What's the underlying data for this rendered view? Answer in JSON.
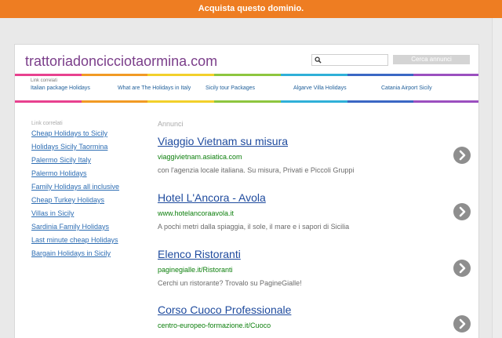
{
  "top_banner": {
    "label": "Acquista questo dominio."
  },
  "site": {
    "title": "trattoriadoncicciotaormina.com"
  },
  "search": {
    "placeholder": "",
    "button_label": "Cerca annunci"
  },
  "top_related": {
    "label": "Link correlati",
    "items": [
      "Italian package Holidays",
      "What are The Holidays in Italy",
      "Sicily tour Packages",
      "Algarve Villa Holidays",
      "Catania Airport Sicily"
    ]
  },
  "sidebar": {
    "label": "Link correlati",
    "items": [
      "Cheap Holidays to Sicily",
      "Holidays Sicily Taormina",
      "Palermo Sicily Italy",
      "Palermo Holidays",
      "Family Holidays all inclusive",
      "Cheap Turkey Holidays",
      "Villas in Sicily",
      "Sardinia Family Holidays",
      "Last minute cheap Holidays",
      "Bargain Holidays in Sicily"
    ]
  },
  "ads": {
    "label": "Annunci",
    "items": [
      {
        "title": "Viaggio Vietnam su misura",
        "url": "viaggivietnam.asiatica.com",
        "desc": "con l'agenzia locale italiana. Su misura, Privati e Piccoli Gruppi"
      },
      {
        "title": "Hotel L'Ancora - Avola",
        "url": "www.hotelancoraavola.it",
        "desc": "A pochi metri dalla spiaggia, il sole, il mare e i sapori di Sicilia"
      },
      {
        "title": "Elenco Ristoranti",
        "url": "paginegialle.it/Ristoranti",
        "desc": "Cerchi un ristorante? Trovalo su PagineGialle!"
      },
      {
        "title": "Corso Cuoco Professionale",
        "url": "centro-europeo-formazione.it/Cuoco",
        "desc": ""
      }
    ]
  },
  "colors": {
    "banner": "#ee7d22",
    "title": "#7b3e8a",
    "ad_title": "#1f4b9e",
    "ad_url": "#0c7f0c",
    "link": "#2d6db3",
    "stripe": [
      "#e8418f",
      "#f19a24",
      "#f2d02b",
      "#8dc63f",
      "#2fb0d8",
      "#3a67c4",
      "#9b4fbf"
    ]
  }
}
